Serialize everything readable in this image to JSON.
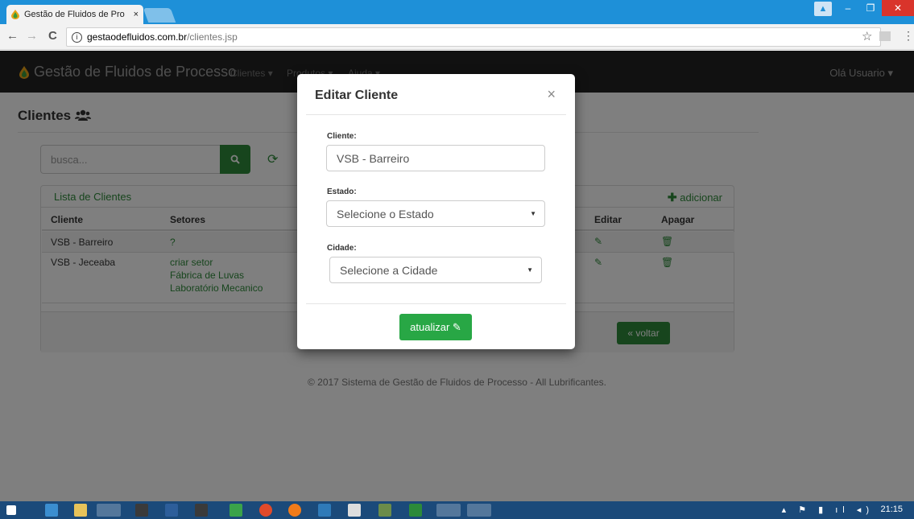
{
  "browser": {
    "tab_title": "Gestão de Fluidos de Pro",
    "tab_close": "×",
    "url_domain": "gestaodefluidos.com.br",
    "url_path": "/clientes.jsp",
    "back": "←",
    "forward": "→",
    "reload": "C",
    "star": "☆",
    "menu": "⋮"
  },
  "window_controls": {
    "user": "▲",
    "minimize": "–",
    "restore": "❐",
    "close": "✕"
  },
  "app": {
    "brand": "Gestão de Fluidos de Processo",
    "nav": [
      "Clientes ▾",
      "Produtos ▾",
      "Ajuda ▾"
    ],
    "user_menu": "Olá Usuario ▾"
  },
  "page": {
    "title": "Clientes",
    "search_placeholder": "busca...",
    "panel_title": "Lista de Clientes",
    "add_label": "adicionar",
    "columns": [
      "Cliente",
      "Setores",
      "Editar",
      "Apagar"
    ],
    "rows": [
      {
        "cliente": "VSB - Barreiro",
        "setores": [
          "?"
        ]
      },
      {
        "cliente": "VSB - Jeceaba",
        "setores": [
          "criar setor",
          "Fábrica de Luvas",
          "Laboratório Mecanico"
        ]
      }
    ],
    "back_label": "voltar",
    "footer": "© 2017 Sistema de Gestão de Fluidos de Processo - All Lubrificantes."
  },
  "modal": {
    "title": "Editar Cliente",
    "close": "×",
    "cliente_label": "Cliente:",
    "cliente_value": "VSB - Barreiro",
    "estado_label": "Estado:",
    "estado_value": "Selecione o Estado",
    "cidade_label": "Cidade:",
    "cidade_value": "Selecione a Cidade",
    "submit_label": "atualizar"
  },
  "taskbar": {
    "clock": "21:15"
  }
}
